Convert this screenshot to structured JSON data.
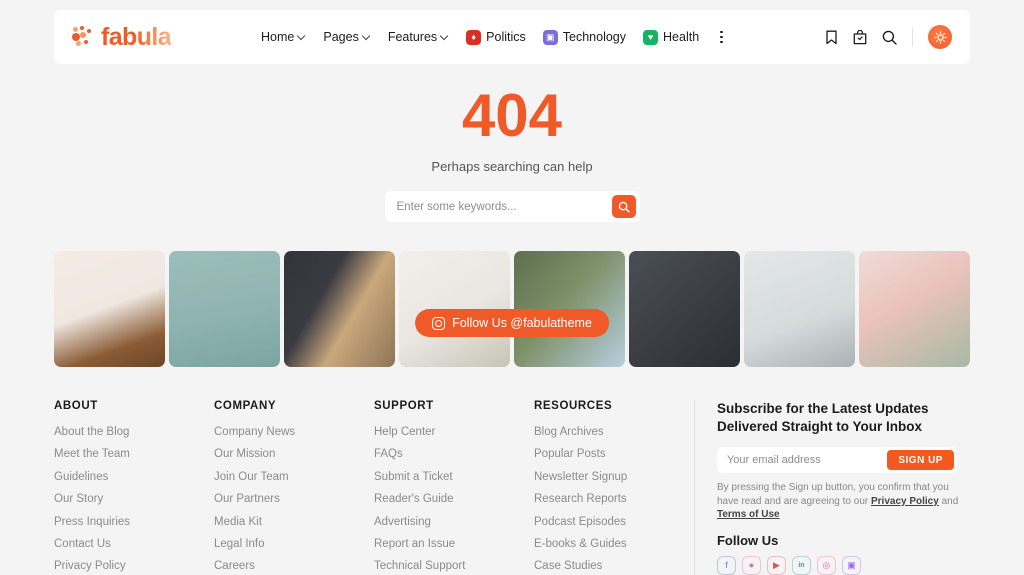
{
  "brand": {
    "name": "fabula",
    "accent": "#f05a28",
    "logo_icon": "dot-cluster-icon"
  },
  "header": {
    "nav": [
      {
        "label": "Home",
        "has_dropdown": true
      },
      {
        "label": "Pages",
        "has_dropdown": true
      },
      {
        "label": "Features",
        "has_dropdown": true
      }
    ],
    "categories": [
      {
        "label": "Politics",
        "icon": "flame-icon",
        "color": "#d93025",
        "glyph": "♦"
      },
      {
        "label": "Technology",
        "icon": "chip-icon",
        "color": "#7b6ce0",
        "glyph": "▣"
      },
      {
        "label": "Health",
        "icon": "heart-pulse-icon",
        "color": "#16b364",
        "glyph": "♥"
      }
    ],
    "more_menu": "kebab-menu-icon",
    "actions": [
      {
        "name": "bookmark-icon"
      },
      {
        "name": "shopping-bag-icon"
      },
      {
        "name": "search-icon"
      }
    ],
    "theme_toggle": {
      "name": "sun-icon",
      "color": "#f05a28"
    }
  },
  "hero": {
    "code": "404",
    "subtitle": "Perhaps searching can help",
    "search_placeholder": "Enter some keywords...",
    "search_value": "",
    "search_button_icon": "search-icon"
  },
  "gallery": {
    "follow_label": "Follow Us @fabulatheme",
    "follow_icon": "instagram-icon",
    "images": [
      {
        "alt": "bed-with-coffee-and-book",
        "c1": "#efe7e0",
        "c2": "#f5efe8",
        "c3": "#8a5c36"
      },
      {
        "alt": "bicycle-wheel-on-teal-wall",
        "c1": "#8fb3b0",
        "c2": "#9fc0bd",
        "c3": "#5d7e7c"
      },
      {
        "alt": "breakfast-tray-with-berries",
        "c1": "#3a3a42",
        "c2": "#c9a87c",
        "c3": "#2c2c34"
      },
      {
        "alt": "notebook-flatlay-with-lavender",
        "c1": "#e9e6e1",
        "c2": "#f2efe9",
        "c3": "#c2c0b4"
      },
      {
        "alt": "women-in-green-and-blue-dresses",
        "c1": "#5f6f4e",
        "c2": "#b7cfe0",
        "c3": "#8aa173"
      },
      {
        "alt": "dark-living-room-interior",
        "c1": "#3d4146",
        "c2": "#6d7278",
        "c3": "#2b2e32"
      },
      {
        "alt": "gray-sofa-in-bright-room",
        "c1": "#d5dadb",
        "c2": "#e3e7e8",
        "c3": "#9aa3a6"
      },
      {
        "alt": "pink-wall-with-sage-bedding",
        "c1": "#e9c2bb",
        "c2": "#a8b9a4",
        "c3": "#f0dcd6"
      }
    ]
  },
  "footer": {
    "columns": [
      {
        "title": "ABOUT",
        "links": [
          "About the Blog",
          "Meet the Team",
          "Guidelines",
          "Our Story",
          "Press Inquiries",
          "Contact Us",
          "Privacy Policy"
        ]
      },
      {
        "title": "COMPANY",
        "links": [
          "Company News",
          "Our Mission",
          "Join Our Team",
          "Our Partners",
          "Media Kit",
          "Legal Info",
          "Careers"
        ]
      },
      {
        "title": "SUPPORT",
        "links": [
          "Help Center",
          "FAQs",
          "Submit a Ticket",
          "Reader's Guide",
          "Advertising",
          "Report an Issue",
          "Technical Support"
        ]
      },
      {
        "title": "RESOURCES",
        "links": [
          "Blog Archives",
          "Popular Posts",
          "Newsletter Signup",
          "Research Reports",
          "Podcast Episodes",
          "E-books & Guides",
          "Case Studies"
        ]
      }
    ],
    "subscribe": {
      "title": "Subscribe for the Latest Updates Delivered Straight to Your Inbox",
      "email_placeholder": "Your email address",
      "email_value": "",
      "button_label": "SIGN UP",
      "note_prefix": "By pressing the Sign up button, you confirm that you have read and are agreeing to our ",
      "privacy_link": "Privacy Policy",
      "note_middle": " and ",
      "terms_link": "Terms of Use"
    },
    "follow": {
      "title": "Follow Us",
      "socials": [
        {
          "name": "facebook-icon",
          "color": "#5b7bd5",
          "glyph": "f"
        },
        {
          "name": "dribbble-icon",
          "color": "#e06b9c",
          "glyph": "●"
        },
        {
          "name": "youtube-icon",
          "color": "#e05555",
          "glyph": "▶"
        },
        {
          "name": "linkedin-icon",
          "color": "#4f93b8",
          "glyph": "in"
        },
        {
          "name": "instagram-icon",
          "color": "#e06b9c",
          "glyph": "◎"
        },
        {
          "name": "twitch-icon",
          "color": "#9b6cd8",
          "glyph": "▣"
        }
      ]
    }
  }
}
